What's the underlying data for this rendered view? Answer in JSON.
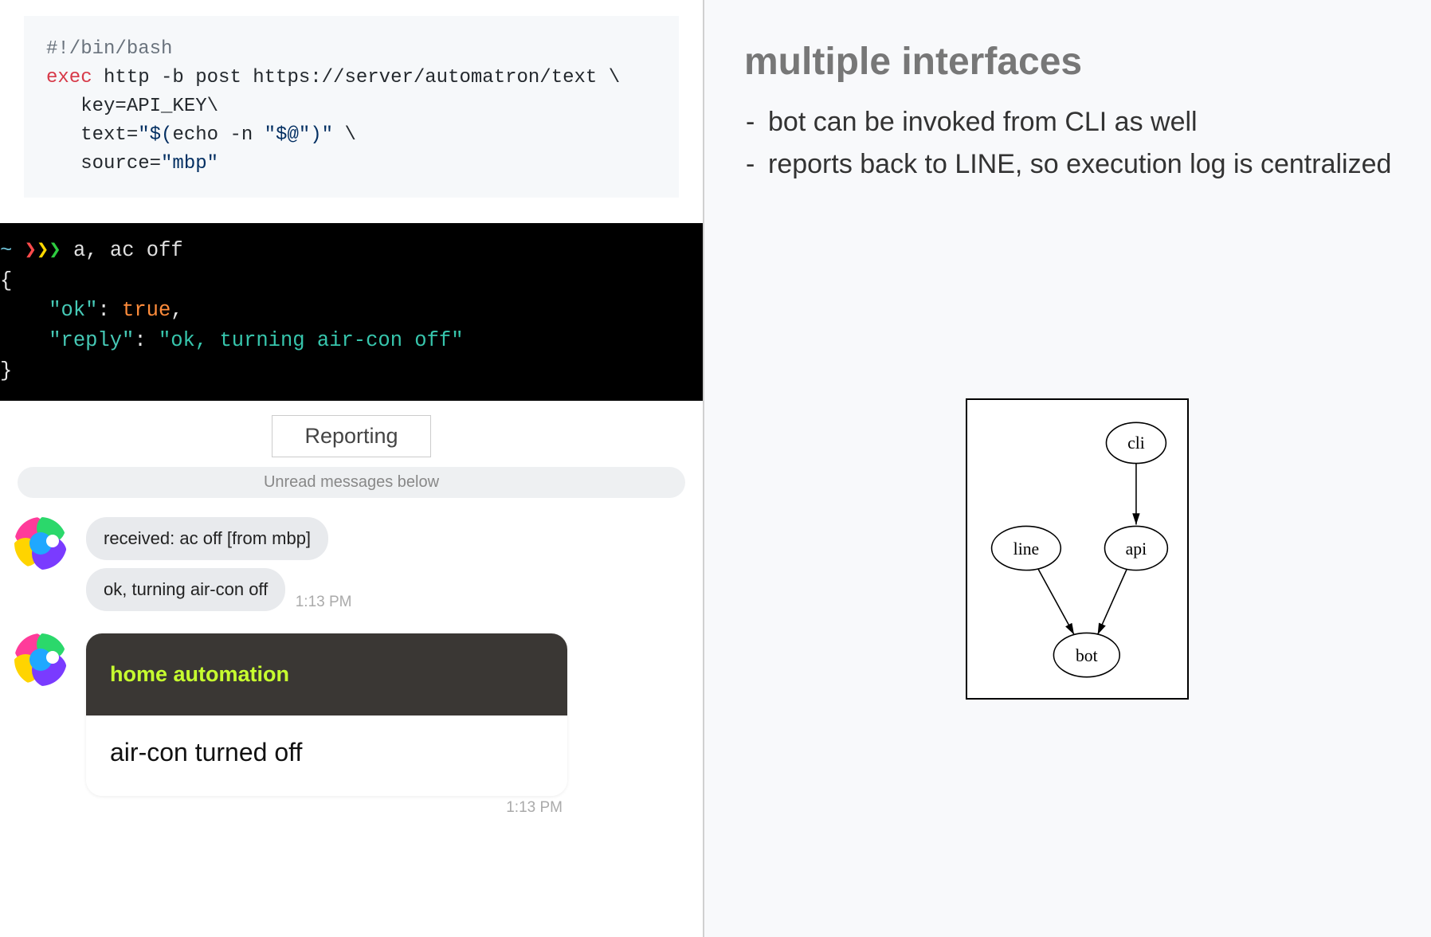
{
  "code": {
    "shebang": "#!/bin/bash",
    "kw_exec": "exec",
    "l2_rest": " http -b post https://server/automatron/text \\",
    "l3a": "   key=API_KEY\\",
    "l4a": "   text=",
    "l4b": "\"$(",
    "l4c": "echo",
    "l4d": " -n ",
    "l4e": "\"$@\"",
    "l4f": ")\"",
    "l4g": " \\",
    "l5a": "   source=",
    "l5b": "\"mbp\""
  },
  "terminal": {
    "prompt_tilde": "~ ",
    "arrow1": "❯",
    "arrow2": "❯",
    "arrow3": "❯",
    "cmd": " a, ac off",
    "brace_open": "{",
    "prop_ok": "\"ok\"",
    "colon_space": ": ",
    "true_val": "true",
    "comma": ",",
    "prop_reply": "\"reply\"",
    "reply_val": "\"ok, turning air-con off\"",
    "brace_close": "}"
  },
  "chat": {
    "section_label": "Reporting",
    "unread": "Unread messages below",
    "msg1": "received: ac off [from mbp]",
    "msg2": "ok, turning air-con off",
    "time1": "1:13 PM",
    "card_header": "home automation",
    "card_body": "air-con turned off",
    "time2": "1:13 PM"
  },
  "right": {
    "heading": "multiple interfaces",
    "bullets": [
      "bot can be invoked from CLI as well",
      "reports back to LINE, so execution log is centralized"
    ]
  },
  "diagram": {
    "nodes": {
      "cli": "cli",
      "line": "line",
      "api": "api",
      "bot": "bot"
    }
  }
}
